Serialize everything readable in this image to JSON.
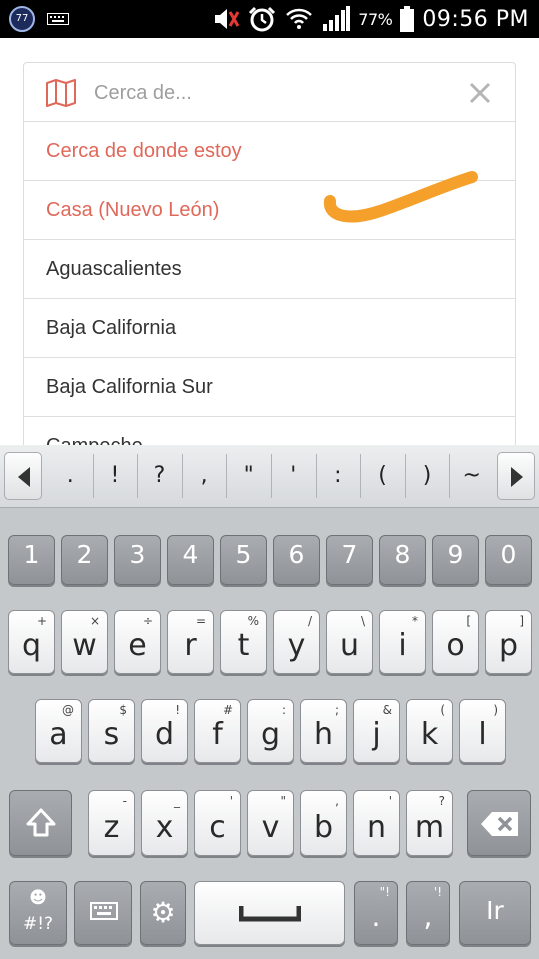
{
  "status_bar": {
    "notification_badge": "77",
    "battery_percent": "77%",
    "time": "09:56 PM",
    "icons": [
      "keyboard-icon",
      "muted-volume-icon",
      "alarm-icon",
      "wifi-icon",
      "signal-icon",
      "battery-icon"
    ]
  },
  "location_picker": {
    "search_placeholder": "Cerca de...",
    "icons": [
      "map-icon",
      "close-icon"
    ],
    "accent_color": "#e0685a",
    "options": [
      "Cerca de donde estoy",
      "Casa (Nuevo León)",
      "Aguascalientes",
      "Baja California",
      "Baja California Sur",
      "Campeche"
    ]
  },
  "annotation": {
    "checkmark_color": "#f4a02a"
  },
  "keyboard": {
    "symbols": [
      ".",
      "!",
      "?",
      ",",
      "\"",
      "'",
      ":",
      "(",
      ")",
      "~"
    ],
    "number_row": [
      "1",
      "2",
      "3",
      "4",
      "5",
      "6",
      "7",
      "8",
      "9",
      "0"
    ],
    "row1": [
      {
        "key": "q",
        "alt": "+"
      },
      {
        "key": "w",
        "alt": "×"
      },
      {
        "key": "e",
        "alt": "÷"
      },
      {
        "key": "r",
        "alt": "="
      },
      {
        "key": "t",
        "alt": "%"
      },
      {
        "key": "y",
        "alt": "/"
      },
      {
        "key": "u",
        "alt": "\\"
      },
      {
        "key": "i",
        "alt": "*"
      },
      {
        "key": "o",
        "alt": "["
      },
      {
        "key": "p",
        "alt": "]"
      }
    ],
    "row2": [
      {
        "key": "a",
        "alt": "@"
      },
      {
        "key": "s",
        "alt": "$"
      },
      {
        "key": "d",
        "alt": "!"
      },
      {
        "key": "f",
        "alt": "#"
      },
      {
        "key": "g",
        "alt": ":"
      },
      {
        "key": "h",
        "alt": ";"
      },
      {
        "key": "j",
        "alt": "&"
      },
      {
        "key": "k",
        "alt": "("
      },
      {
        "key": "l",
        "alt": ")"
      }
    ],
    "row3": [
      {
        "key": "z",
        "alt": "-"
      },
      {
        "key": "x",
        "alt": "_"
      },
      {
        "key": "c",
        "alt": "'"
      },
      {
        "key": "v",
        "alt": "\""
      },
      {
        "key": "b",
        "alt": ","
      },
      {
        "key": "n",
        "alt": "'"
      },
      {
        "key": "m",
        "alt": "?"
      }
    ],
    "symbols_key": "#!?",
    "period_key": ".",
    "comma_key": ",",
    "period_alt": "\"!",
    "comma_alt": "'!",
    "lang_key": "Ir"
  }
}
